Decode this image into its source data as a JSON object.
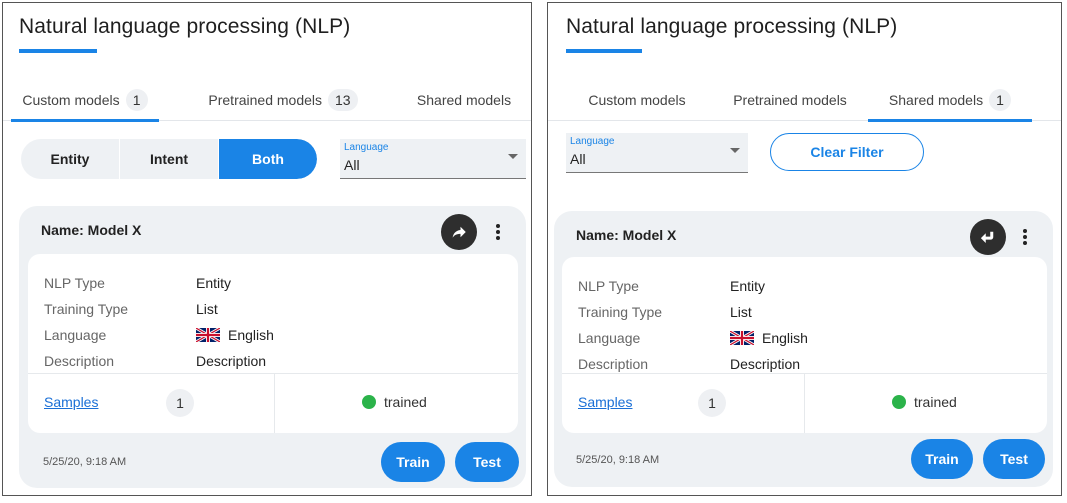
{
  "title": "Natural language processing (NLP)",
  "tabs": [
    {
      "label": "Custom models",
      "count": "1"
    },
    {
      "label": "Pretrained models",
      "count": "13"
    },
    {
      "label": "Shared models",
      "count": "1"
    }
  ],
  "segment": [
    "Entity",
    "Intent",
    "Both"
  ],
  "language_filter": {
    "label": "Language",
    "value": "All"
  },
  "clear_filter_label": "Clear Filter",
  "model": {
    "name": "Name: Model X",
    "rows": [
      {
        "key": "NLP Type",
        "value": "Entity"
      },
      {
        "key": "Training Type",
        "value": "List"
      },
      {
        "key": "Language",
        "value": "English"
      },
      {
        "key": "Description",
        "value": "Description"
      }
    ],
    "samples_label": "Samples",
    "samples_count": "1",
    "status": "trained",
    "timestamp": "5/25/20, 9:18 AM"
  },
  "actions": {
    "train": "Train",
    "test": "Test"
  },
  "colors": {
    "accent": "#1a84e6",
    "trained": "#2bb34a",
    "card": "#eef1f4"
  },
  "icons": [
    "share-forward-icon",
    "share-return-icon",
    "more-vert-icon",
    "uk-flag-icon",
    "status-dot-icon",
    "caret-down-icon"
  ]
}
